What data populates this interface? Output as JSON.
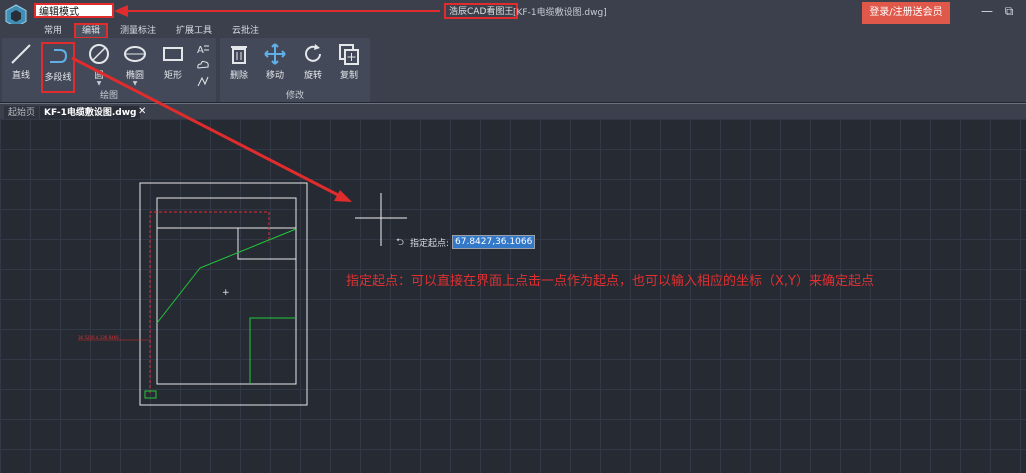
{
  "titlebar": {
    "mode_label": "编辑模式",
    "app_title": "浩辰CAD看图王",
    "doc_title": "[KF-1电缆敷设图.dwg]",
    "login_button": "登录/注册送会员",
    "minimize": "—",
    "restore": "⧉"
  },
  "menu": {
    "items": [
      "常用",
      "编辑",
      "测量标注",
      "扩展工具",
      "云批注"
    ],
    "active": "编辑"
  },
  "ribbon": {
    "draw_group": {
      "label": "绘图",
      "tools": [
        "直线",
        "多段线",
        "圆",
        "椭圆",
        "矩形"
      ]
    },
    "modify_group": {
      "label": "修改",
      "tools": [
        "删除",
        "移动",
        "旋转",
        "复制"
      ]
    }
  },
  "tabs": {
    "start": "起始页",
    "file": "KF-1电缆敷设图.dwg",
    "close": "✕"
  },
  "command": {
    "label": "指定起点:",
    "value": "67.8427,36.1066"
  },
  "annotation": "指定起点：可以直接在界面上点击一点作为起点，也可以输入相应的坐标（X,Y）来确定起点",
  "drawing": {
    "dim_text": "3K 5256 4.136 6466"
  },
  "colors": {
    "accent": "#e02c2c",
    "login": "#e0584a",
    "canvas": "#262a33",
    "green_lines": "#21c83a"
  }
}
